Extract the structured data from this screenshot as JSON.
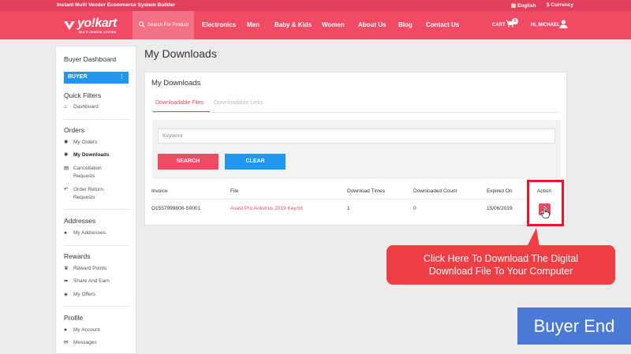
{
  "topbar": {
    "tagline": "Instant Multi Vendor Ecommerce System Builder",
    "language": "English",
    "currency": "$ Currency"
  },
  "header": {
    "logo_text": "yo!kart",
    "logo_sub": "MULTI VENDOR SYSTEM",
    "search_label": "Search For Product",
    "nav": [
      "Electronics",
      "Men",
      "Baby & Kids",
      "Women",
      "About Us",
      "Blog",
      "Contact Us"
    ],
    "cart_label": "CART",
    "cart_count": "0",
    "greeting": "HI, MICHAEL"
  },
  "sidebar": {
    "title": "Buyer Dashboard",
    "role_button": "BUYER",
    "role_menu": "⋮",
    "sections": {
      "quick_filters": "Quick Filters",
      "orders": "Orders",
      "addresses": "Addresses",
      "rewards": "Rewards",
      "profile": "Profile"
    },
    "items": {
      "dashboard": "Dashboard",
      "my_orders": "My Orders",
      "my_downloads": "My Downloads",
      "cancellation_requests_1": "Cancellation",
      "cancellation_requests_2": "Requests",
      "order_return_1": "Order Return",
      "order_return_2": "Requests",
      "my_addresses": "My Addresses",
      "reward_points": "Reward Points",
      "share_and_earn": "Share And Earn",
      "my_offers": "My Offers",
      "my_account": "My Account",
      "messages": "Messages"
    }
  },
  "main": {
    "page_title": "My Downloads",
    "panel_title": "My Downloads",
    "tabs": [
      "Downloadable Files",
      "Downloadable Links"
    ],
    "keyword_placeholder": "Keyword",
    "search_button": "SEARCH",
    "clear_button": "CLEAR",
    "table": {
      "headers": [
        "Invoice",
        "File",
        "Download Times",
        "Downloaded Count",
        "Expired On",
        "Action"
      ],
      "rows": [
        {
          "invoice": "O1557999808-S0001",
          "file": "Avast Pro Antivirus 2019 Key.txt",
          "download_times": "1",
          "downloaded_count": "0",
          "expired_on": "15/06/2019"
        }
      ]
    }
  },
  "callout": {
    "line1": "Click Here To Download The Digital",
    "line2": "Download File To Your Computer"
  },
  "badge": {
    "text": "Buyer End"
  },
  "colors": {
    "brand": "#f04a65",
    "blue": "#2196f3",
    "callout": "#ef3f43",
    "badge": "#4a7ad6"
  }
}
